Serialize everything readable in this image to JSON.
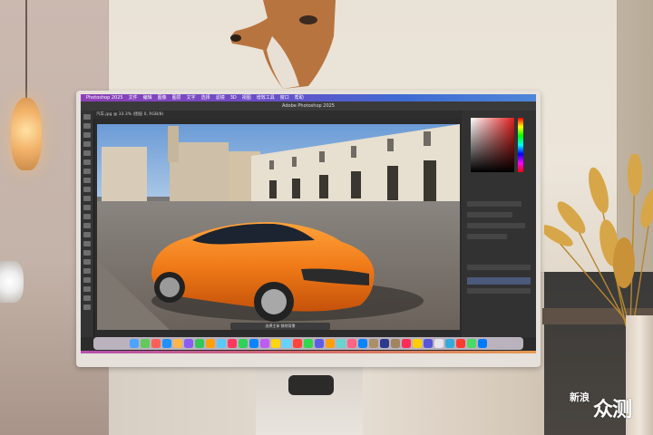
{
  "scene": {
    "app_title": "Adobe Photoshop 2025",
    "menubar_items": [
      "Photoshop 2025",
      "文件",
      "编辑",
      "图像",
      "图层",
      "文字",
      "选择",
      "滤镜",
      "3D",
      "视图",
      "增效工具",
      "窗口",
      "帮助"
    ],
    "document_tab": "汽车.jpg @ 33.3% (图层 0, RGB/8)",
    "statusbar_text": "选择主体   移除背景",
    "dock_colors": [
      "#4da3ff",
      "#63c95a",
      "#ff5f57",
      "#1e90ff",
      "#ffb648",
      "#8b5cf6",
      "#34c759",
      "#ff9f0a",
      "#5ac8fa",
      "#ff375f",
      "#30d158",
      "#0a84ff",
      "#bf5af2",
      "#ffd60a",
      "#64d2ff",
      "#ff453a",
      "#32d74b",
      "#5e5ce6",
      "#ff9f0a",
      "#66d4cf",
      "#ff6482",
      "#0a84ff",
      "#ac8e68",
      "#2b3a8f",
      "#a2845e",
      "#ff2d55",
      "#ffcc00",
      "#5856d6",
      "#e5e5ea",
      "#34aadc",
      "#ff3b30",
      "#4cd964",
      "#007aff"
    ],
    "watermark": {
      "small": "新浪",
      "brand": "众测"
    },
    "accent": "#e9671c"
  }
}
